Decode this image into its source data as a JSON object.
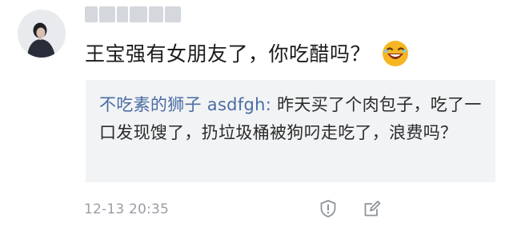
{
  "comment": {
    "text": "王宝强有女朋友了，你吃醋吗？",
    "emoji_icon": "laughing-face-icon",
    "quote": {
      "author": "不吃素的狮子 asdfgh:",
      "body": " 昨天买了个肉包子，吃了一口发现馊了，扔垃圾桶被狗叼走吃了，浪费吗？"
    },
    "timestamp": "12-13 20:35",
    "actions": [
      "shield-icon",
      "edit-icon"
    ]
  },
  "colors": {
    "text": "#1c1c1e",
    "author_link": "#4a6da3",
    "quote_bg": "#f2f3f5",
    "meta": "#9a9ea5"
  }
}
